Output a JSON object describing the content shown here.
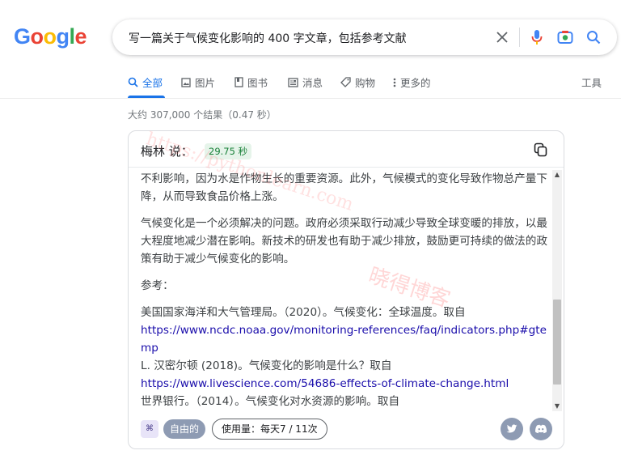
{
  "logo": {
    "letters": [
      "G",
      "o",
      "o",
      "g",
      "l",
      "e"
    ],
    "colors": [
      "#4285f4",
      "#ea4335",
      "#fbbc05",
      "#4285f4",
      "#34a853",
      "#ea4335"
    ]
  },
  "search": {
    "query": "写一篇关于气候变化影响的 400 字文章，包括参考文献"
  },
  "tabs": [
    {
      "label": "全部",
      "icon": "search-icon",
      "active": true
    },
    {
      "label": "图片",
      "icon": "image-icon"
    },
    {
      "label": "图书",
      "icon": "book-icon"
    },
    {
      "label": "消息",
      "icon": "news-icon"
    },
    {
      "label": "购物",
      "icon": "tag-icon"
    },
    {
      "label": "更多的",
      "icon": "more-vert-icon"
    }
  ],
  "tools_label": "工具",
  "result_stats": "大约 307,000 个结果（0.47 秒）",
  "card": {
    "title": "梅林 说：",
    "timer": "29.75 秒",
    "paragraphs": [
      "不利影响，因为水是作物生长的重要资源。此外，气候模式的变化导致作物总产量下降，从而导致食品价格上涨。",
      "气候变化是一个必须解决的问题。政府必须采取行动减少导致全球变暖的排放，以最大程度地减少潜在影响。新技术的研发也有助于减少排放，鼓励更可持续的做法的政策有助于减少气候变化的影响。"
    ],
    "refs_heading": "参考：",
    "references": [
      {
        "text": "美国国家海洋和大气管理局。（2020）。气候变化：全球温度。取自",
        "link": "https://www.ncdc.noaa.gov/monitoring-references/faq/indicators.php#gtemp"
      },
      {
        "text": "L. 汉密尔顿 (2018)。气候变化的影响是什么？取自",
        "link": "https://www.livescience.com/54686-effects-of-climate-change.html"
      },
      {
        "text": "世界银行。（2014）。气候变化对水资源的影响。取自",
        "link": ""
      }
    ],
    "free_label": "自由的",
    "usage_label": "使用量：每天7 / 11次"
  },
  "watermark": {
    "url": "https://pythonlearn.com",
    "brand": "晓得博客"
  }
}
